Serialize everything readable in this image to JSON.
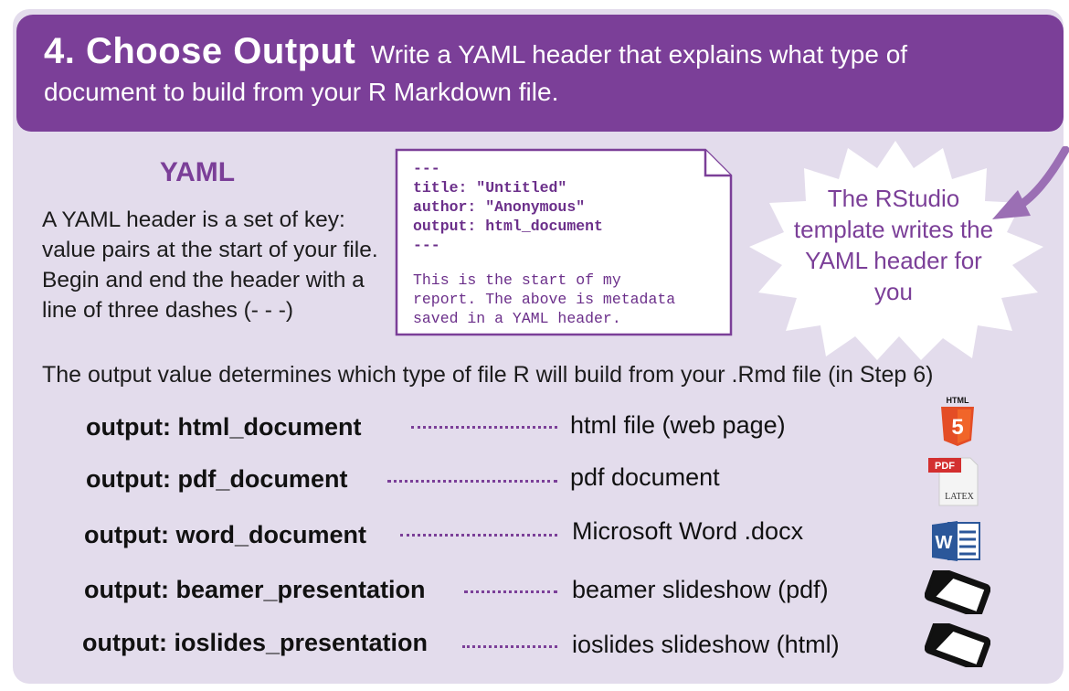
{
  "header": {
    "step_title": "4. Choose Output",
    "description_line1": "Write a YAML header that explains what type of",
    "description_line2": "document to build from your R Markdown file."
  },
  "yaml_section": {
    "title": "YAML",
    "description": "A YAML header is a set of key: value pairs at the start of your file. Begin and end the header with a line of three dashes (- - -)"
  },
  "code_example": {
    "header_text": "---\ntitle: \"Untitled\"\nauthor: \"Anonymous\"\noutput: html_document\n---",
    "body_text": "This is the start of my\nreport. The above is metadata\nsaved in a YAML header."
  },
  "callout": {
    "text": "The RStudio template writes the YAML header for you"
  },
  "output_intro": "The output value determines which type of file R will build from your .Rmd file (in Step 6)",
  "outputs": [
    {
      "key": "output: html_document",
      "value": "html file (web page)",
      "icon": "html5-icon",
      "icon_label": "HTML"
    },
    {
      "key": "output: pdf_document",
      "value": "pdf document",
      "icon": "pdf-latex-icon",
      "icon_label": "PDF",
      "icon_sub": "LATEX"
    },
    {
      "key": "output: word_document",
      "value": "Microsoft Word .docx",
      "icon": "word-icon",
      "icon_label": "W"
    },
    {
      "key": "output: beamer_presentation",
      "value": "beamer slideshow (pdf)",
      "icon": "slideshow-icon"
    },
    {
      "key": "output: ioslides_presentation",
      "value": "ioslides slideshow (html)",
      "icon": "slideshow-icon"
    }
  ],
  "colors": {
    "brand_purple": "#7b3f98",
    "panel_bg": "#e3dcec",
    "html5_orange": "#e44d26",
    "pdf_red": "#d32f2f",
    "word_blue": "#2b579a"
  }
}
